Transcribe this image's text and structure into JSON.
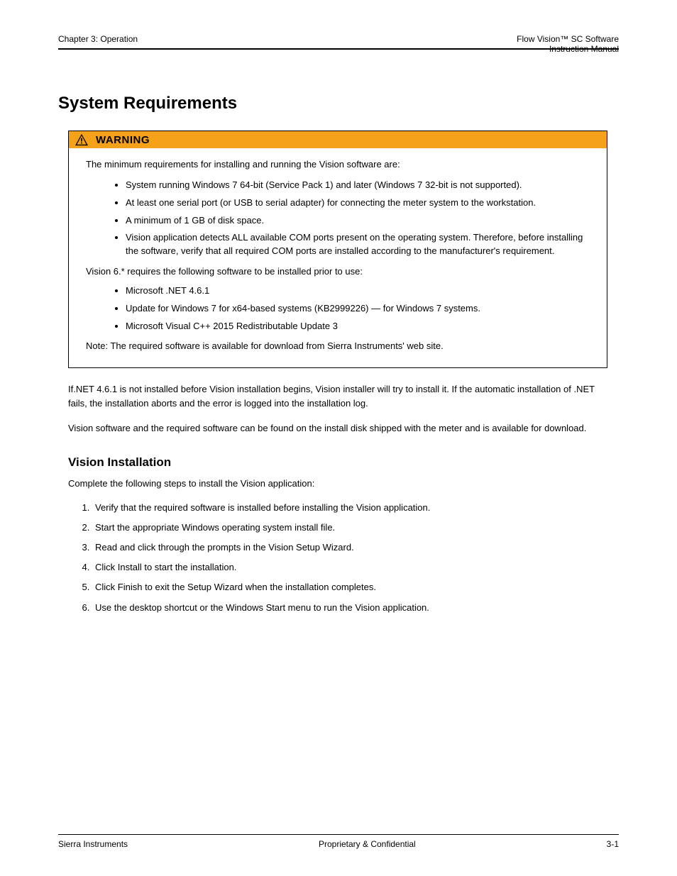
{
  "header": {
    "left": "Chapter 3: Operation",
    "right_line1": "Flow Vision™ SC Software",
    "right_line2": "Instruction Manual"
  },
  "section_title": "System Requirements",
  "warning": {
    "label": "WARNING",
    "lead": "The minimum requirements for installing and running the Vision software are:",
    "items1": [
      "System running Windows 7 64-bit (Service Pack 1) and later (Windows 7 32-bit is not supported).",
      "At least one serial port (or USB to serial adapter) for connecting the meter system to the workstation.",
      "A minimum of 1 GB of disk space.",
      "Vision application detects ALL available COM ports present on the operating system. Therefore, before installing the software, verify that all required COM ports are installed according to the manufacturer's requirement."
    ],
    "mid": "Vision 6.* requires the following software to be installed prior to use:",
    "items2": [
      "Microsoft .NET 4.6.1",
      "Update for Windows 7 for x64-based systems (KB2999226) — for Windows 7 systems.",
      "Microsoft Visual C++ 2015 Redistributable Update 3"
    ],
    "tail": "Note: The required software is available for download from Sierra Instruments' web site."
  },
  "body": {
    "p1": "If.NET 4.6.1 is not installed before Vision installation begins, Vision installer will try to install it. If the automatic installation of .NET fails, the installation aborts and the error is logged into the installation log.",
    "p2": "Vision software and the required software can be found on the install disk shipped with the meter and is available for download."
  },
  "subhead": "Vision Installation",
  "install_intro": "Complete the following steps to install the Vision application:",
  "steps": [
    "Verify that the required software is installed before installing the Vision application.",
    "Start the appropriate Windows operating system install file.",
    "Read and click through the prompts in the Vision Setup Wizard.",
    "Click Install to start the installation.",
    "Click Finish to exit the Setup Wizard when the installation completes.",
    "Use the desktop shortcut or the Windows Start menu to run the Vision application."
  ],
  "footer": {
    "left": "Sierra Instruments",
    "center": "Proprietary & Confidential",
    "right": "3-1"
  }
}
